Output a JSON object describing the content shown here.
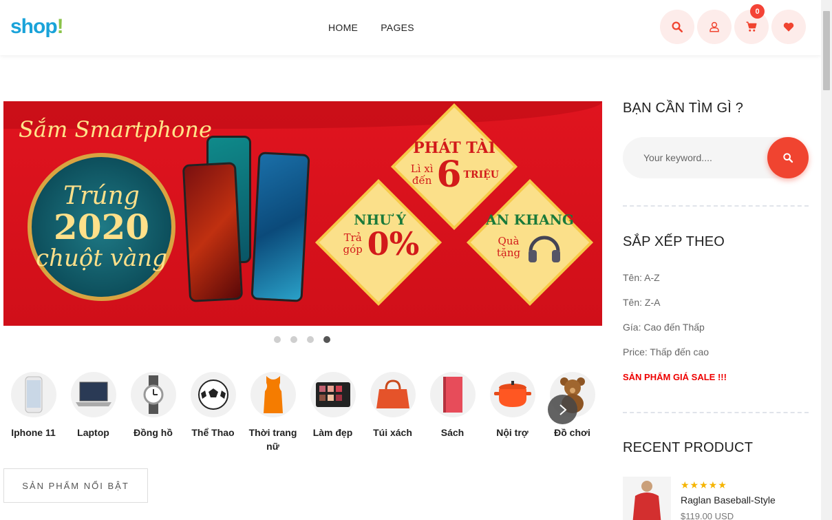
{
  "brand": {
    "logo_part1": "shop",
    "logo_part2": "!"
  },
  "nav": {
    "items": [
      "HOME",
      "PAGES"
    ]
  },
  "header_icons": {
    "search": "search-icon",
    "account": "user-icon",
    "cart": "cart-icon",
    "wishlist": "heart-icon",
    "cart_count": "0"
  },
  "colors": {
    "accent": "#f04430",
    "icon_bg": "#fdecea",
    "sale": "#e00000",
    "star": "#f5b400"
  },
  "banner": {
    "headline": "Sắm Smartphone",
    "circle_line1": "Trúng",
    "circle_line2": "2020",
    "circle_line3": "chuột vàng",
    "diamond_top_title": "PHÁT TÀI",
    "diamond_top_text": "Lì xì đến",
    "diamond_top_big": "6",
    "diamond_top_unit": "TRIỆU",
    "diamond_left_title": "NHƯ Ý",
    "diamond_left_text": "Trả góp",
    "diamond_left_big": "0%",
    "diamond_right_title": "AN KHANG",
    "diamond_right_text": "Quà tặng",
    "slide_count": 4,
    "active_slide": 4
  },
  "categories": [
    {
      "label": "Iphone 11",
      "icon": "phone-icon"
    },
    {
      "label": "Laptop",
      "icon": "laptop-icon"
    },
    {
      "label": "Đồng hồ",
      "icon": "watch-icon"
    },
    {
      "label": "Thể Thao",
      "icon": "soccer-ball-icon"
    },
    {
      "label": "Thời trang nữ",
      "icon": "dress-icon"
    },
    {
      "label": "Làm đẹp",
      "icon": "makeup-palette-icon"
    },
    {
      "label": "Túi xách",
      "icon": "handbag-icon"
    },
    {
      "label": "Sách",
      "icon": "book-icon"
    },
    {
      "label": "Nội trợ",
      "icon": "pot-icon"
    },
    {
      "label": "Đồ chơi",
      "icon": "teddy-bear-icon"
    }
  ],
  "featured_button": "SẢN PHẨM NỔI BẬT",
  "sidebar": {
    "search_title": "BẠN CẦN TÌM GÌ ?",
    "search_placeholder": "Your keyword....",
    "sort_title": "SẮP XẾP THEO",
    "sort_options": [
      "Tên: A-Z",
      "Tên: Z-A",
      "Gía: Cao đến Thấp",
      "Price: Thấp đến cao"
    ],
    "sale_link": "SẢN PHẨM GIÁ SALE !!!",
    "recent_title": "RECENT PRODUCT",
    "recent": {
      "rating": 5,
      "stars": "★★★★★",
      "name": "Raglan Baseball-Style",
      "price": "$119.00 USD"
    }
  }
}
